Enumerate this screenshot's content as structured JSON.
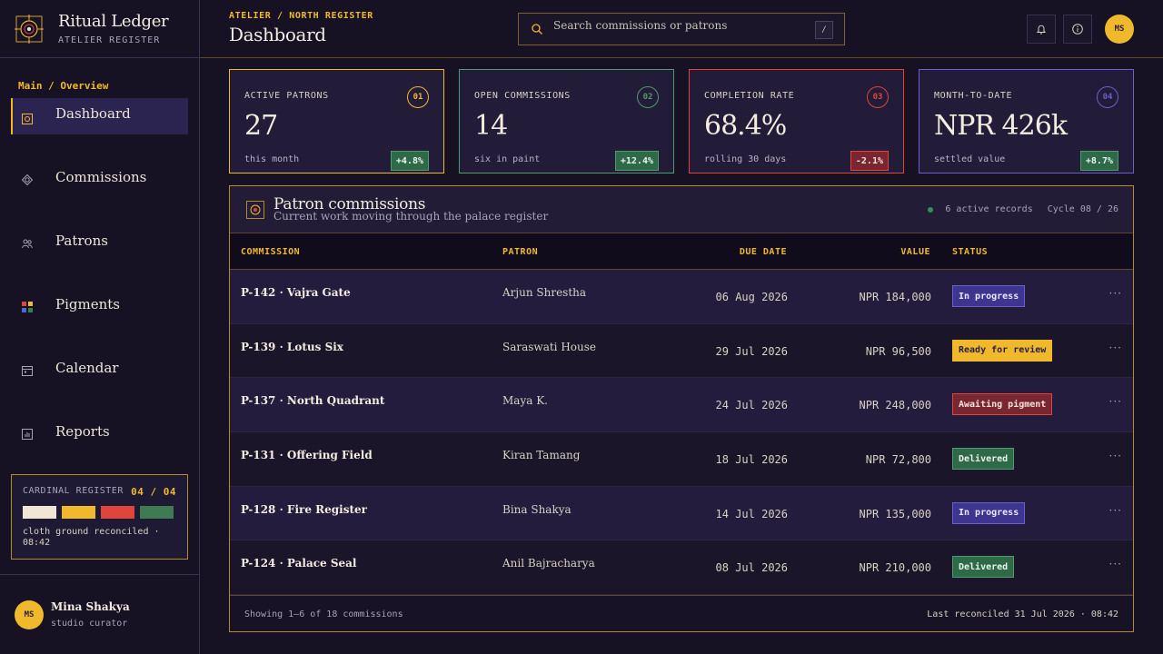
{
  "brand": {
    "title": "Ritual Ledger",
    "subtitle": "ATELIER REGISTER"
  },
  "sidebar": {
    "section_label": "Main / Overview",
    "items": [
      {
        "label": "Dashboard",
        "icon": "mandala-square-icon",
        "active": true
      },
      {
        "label": "Commissions",
        "icon": "lotus-diamond-icon"
      },
      {
        "label": "Patrons",
        "icon": "people-icon"
      },
      {
        "label": "Pigments",
        "icon": "palette-grid-icon"
      },
      {
        "label": "Calendar",
        "icon": "calendar-icon"
      },
      {
        "label": "Reports",
        "icon": "bar-chart-icon"
      }
    ],
    "cardinal": {
      "label": "CARDINAL REGISTER",
      "count": "04 / 04",
      "colors": [
        "#efe6d6",
        "#f0b92c",
        "#e0443a",
        "#3f7a52"
      ],
      "note": "cloth ground reconciled · 08:42"
    },
    "user": {
      "initials": "MS",
      "name": "Mina Shakya",
      "role": "studio curator"
    }
  },
  "header": {
    "breadcrumb": "ATELIER / NORTH REGISTER",
    "title": "Dashboard",
    "search_placeholder": "Search commissions or patrons",
    "search_shortcut": "/",
    "avatar_initials": "MS"
  },
  "stats": [
    {
      "label": "ACTIVE PATRONS",
      "num": "01",
      "value": "27",
      "foot": "this month",
      "delta": "+4.8%",
      "trend": "up",
      "accent": "#f0b92c"
    },
    {
      "label": "OPEN COMMISSIONS",
      "num": "02",
      "value": "14",
      "foot": "six in paint",
      "delta": "+12.4%",
      "trend": "up",
      "accent": "#4f9a72"
    },
    {
      "label": "COMPLETION RATE",
      "num": "03",
      "value": "68.4%",
      "foot": "rolling 30 days",
      "delta": "-2.1%",
      "trend": "down",
      "accent": "#e0443a"
    },
    {
      "label": "MONTH-TO-DATE",
      "num": "04",
      "value": "NPR 426k",
      "foot": "settled value",
      "delta": "+8.7%",
      "trend": "up",
      "accent": "#6b5fd0"
    }
  ],
  "panel": {
    "title": "Patron commissions",
    "subtitle": "Current work moving through the palace register",
    "records": "6 active records",
    "cycle": "Cycle 08 / 26",
    "columns": [
      "COMMISSION",
      "PATRON",
      "DUE DATE",
      "VALUE",
      "STATUS"
    ],
    "rows": [
      {
        "commission": "P-142 · Vajra Gate",
        "patron": "Arjun Shrestha",
        "due": "06 Aug 2026",
        "value": "NPR 184,000",
        "status": "In progress",
        "status_kind": "progress"
      },
      {
        "commission": "P-139 · Lotus Six",
        "patron": "Saraswati House",
        "due": "29 Jul 2026",
        "value": "NPR 96,500",
        "status": "Ready for review",
        "status_kind": "review"
      },
      {
        "commission": "P-137 · North Quadrant",
        "patron": "Maya K.",
        "due": "24 Jul 2026",
        "value": "NPR 248,000",
        "status": "Awaiting pigment",
        "status_kind": "awaiting"
      },
      {
        "commission": "P-131 · Offering Field",
        "patron": "Kiran Tamang",
        "due": "18 Jul 2026",
        "value": "NPR 72,800",
        "status": "Delivered",
        "status_kind": "delivered"
      },
      {
        "commission": "P-128 · Fire Register",
        "patron": "Bina Shakya",
        "due": "14 Jul 2026",
        "value": "NPR 135,000",
        "status": "In progress",
        "status_kind": "progress"
      },
      {
        "commission": "P-124 · Palace Seal",
        "patron": "Anil Bajracharya",
        "due": "08 Jul 2026",
        "value": "NPR 210,000",
        "status": "Delivered",
        "status_kind": "delivered"
      }
    ],
    "row_more": "···",
    "footer_left": "Showing 1–6 of 18 commissions",
    "footer_right": "Last reconciled 31 Jul 2026 · 08:42"
  }
}
